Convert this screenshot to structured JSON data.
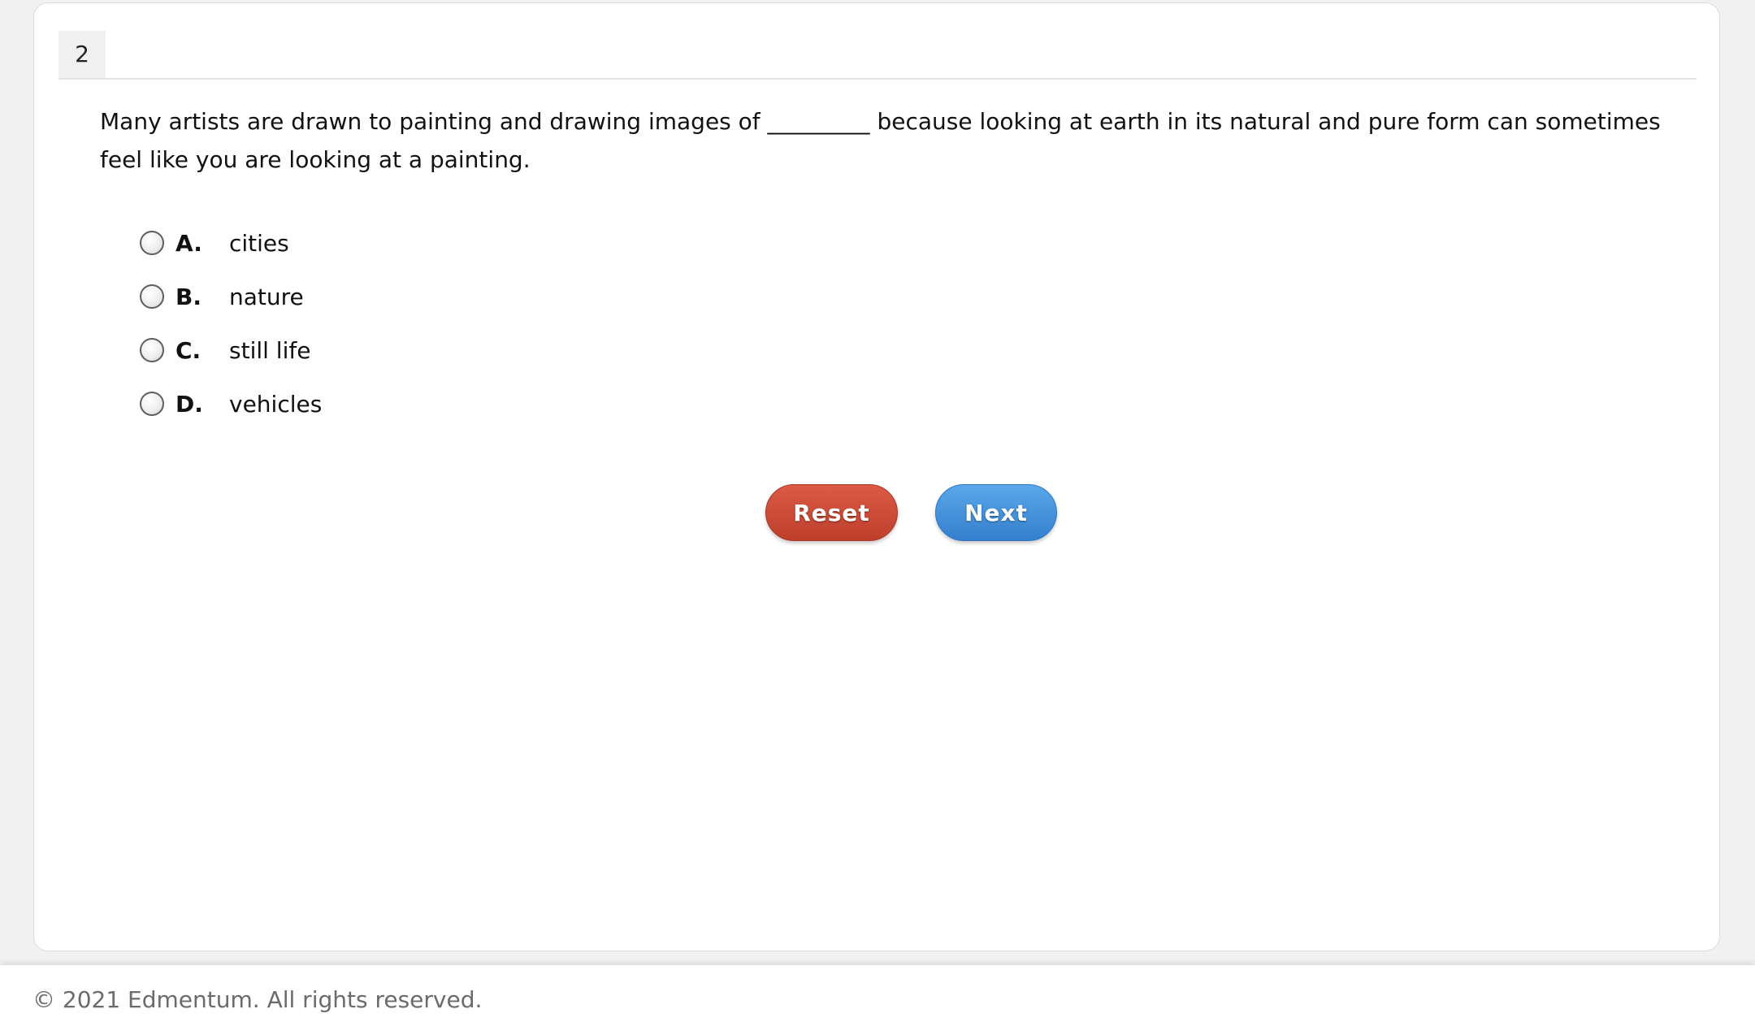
{
  "question": {
    "number": "2",
    "prompt": "Many artists are drawn to painting and drawing images of _________ because looking at earth in its natural and pure form can sometimes feel like you are looking at a painting.",
    "choices": [
      {
        "letter": "A.",
        "text": "cities"
      },
      {
        "letter": "B.",
        "text": "nature"
      },
      {
        "letter": "C.",
        "text": "still life"
      },
      {
        "letter": "D.",
        "text": "vehicles"
      }
    ]
  },
  "buttons": {
    "reset_label": "Reset",
    "next_label": "Next"
  },
  "colors": {
    "reset": "#c94a36",
    "next": "#4291dd"
  },
  "footer": {
    "copyright": "© 2021 Edmentum. All rights reserved."
  }
}
